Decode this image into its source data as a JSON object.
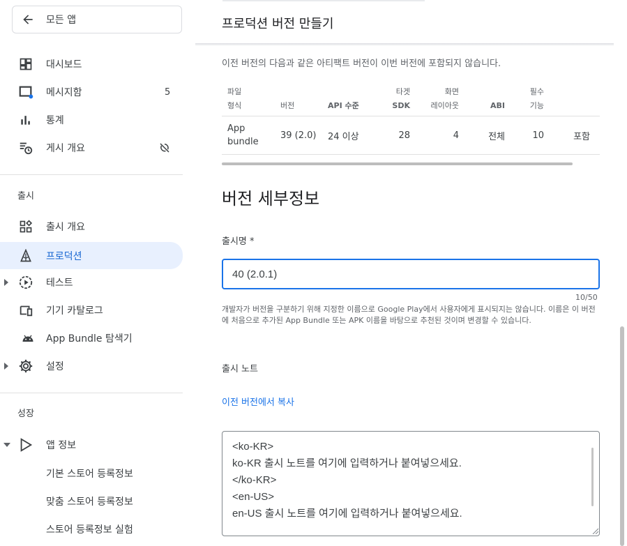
{
  "sidebar": {
    "all_apps": "모든 앱",
    "top_items": [
      {
        "label": "대시보드"
      },
      {
        "label": "메시지함",
        "badge": "5"
      },
      {
        "label": "통계"
      },
      {
        "label": "게시 개요"
      }
    ],
    "release_section": "출시",
    "release_items": [
      {
        "label": "출시 개요"
      },
      {
        "label": "프로덕션"
      },
      {
        "label": "테스트"
      },
      {
        "label": "기기 카탈로그"
      },
      {
        "label": "App Bundle 탐색기"
      },
      {
        "label": "설정"
      }
    ],
    "growth_section": "성장",
    "growth_items": [
      {
        "label": "앱 정보"
      }
    ],
    "growth_sub_items": [
      {
        "label": "기본 스토어 등록정보"
      },
      {
        "label": "맞춤 스토어 등록정보"
      },
      {
        "label": "스토어 등록정보 실험"
      }
    ]
  },
  "main": {
    "title": "프로덕션 버전 만들기",
    "info": "이전 버전의 다음과 같은 아티팩트 버전이 이번 버전에 포함되지 않습니다.",
    "table": {
      "headers": [
        {
          "line1": "파일",
          "line2": "형식",
          "bold": false
        },
        {
          "line1": "",
          "line2": "버전",
          "bold": false
        },
        {
          "line1": "",
          "line2": "API 수준",
          "bold": true
        },
        {
          "line1": "타겟",
          "line2": "SDK",
          "bold": true
        },
        {
          "line1": "화면",
          "line2": "레이아웃",
          "bold": false
        },
        {
          "line1": "",
          "line2": "ABI",
          "bold": true
        },
        {
          "line1": "필수",
          "line2": "기능",
          "bold": false
        },
        {
          "line1": "",
          "line2": "",
          "bold": false
        }
      ],
      "row": [
        "App bundle",
        "39 (2.0)",
        "24 이상",
        "28",
        "4",
        "전체",
        "10",
        "포함"
      ]
    },
    "details_title": "버전 세부정보",
    "release_name_label": "출시명  *",
    "release_name_value": "40 (2.0.1)",
    "counter": "10/50",
    "help": "개발자가 버전을 구분하기 위해 지정한 이름으로 Google Play에서 사용자에게 표시되지는 않습니다. 이름은 이 버전에 처음으로 추가된 App Bundle 또는 APK 이름을 바탕으로 추천된 것이며 변경할 수 있습니다.",
    "notes_label": "출시 노트",
    "copy_link": "이전 버전에서 복사",
    "notes_value": "<ko-KR>\nko-KR 출시 노트를 여기에 입력하거나 붙여넣으세요.\n</ko-KR>\n<en-US>\nen-US 출시 노트를 여기에 입력하거나 붙여넣으세요."
  },
  "colors": {
    "accent": "#1a73e8",
    "active_bg": "#e8f0fe",
    "badge_dot": "#1a73e8"
  },
  "icons": [
    "arrow-left-icon",
    "dashboard-icon",
    "inbox-icon",
    "bar-chart-icon",
    "publishing-overview-icon",
    "sync-off-icon",
    "release-overview-icon",
    "production-icon",
    "test-icon",
    "device-catalog-icon",
    "android-icon",
    "gear-icon",
    "play-icon"
  ]
}
